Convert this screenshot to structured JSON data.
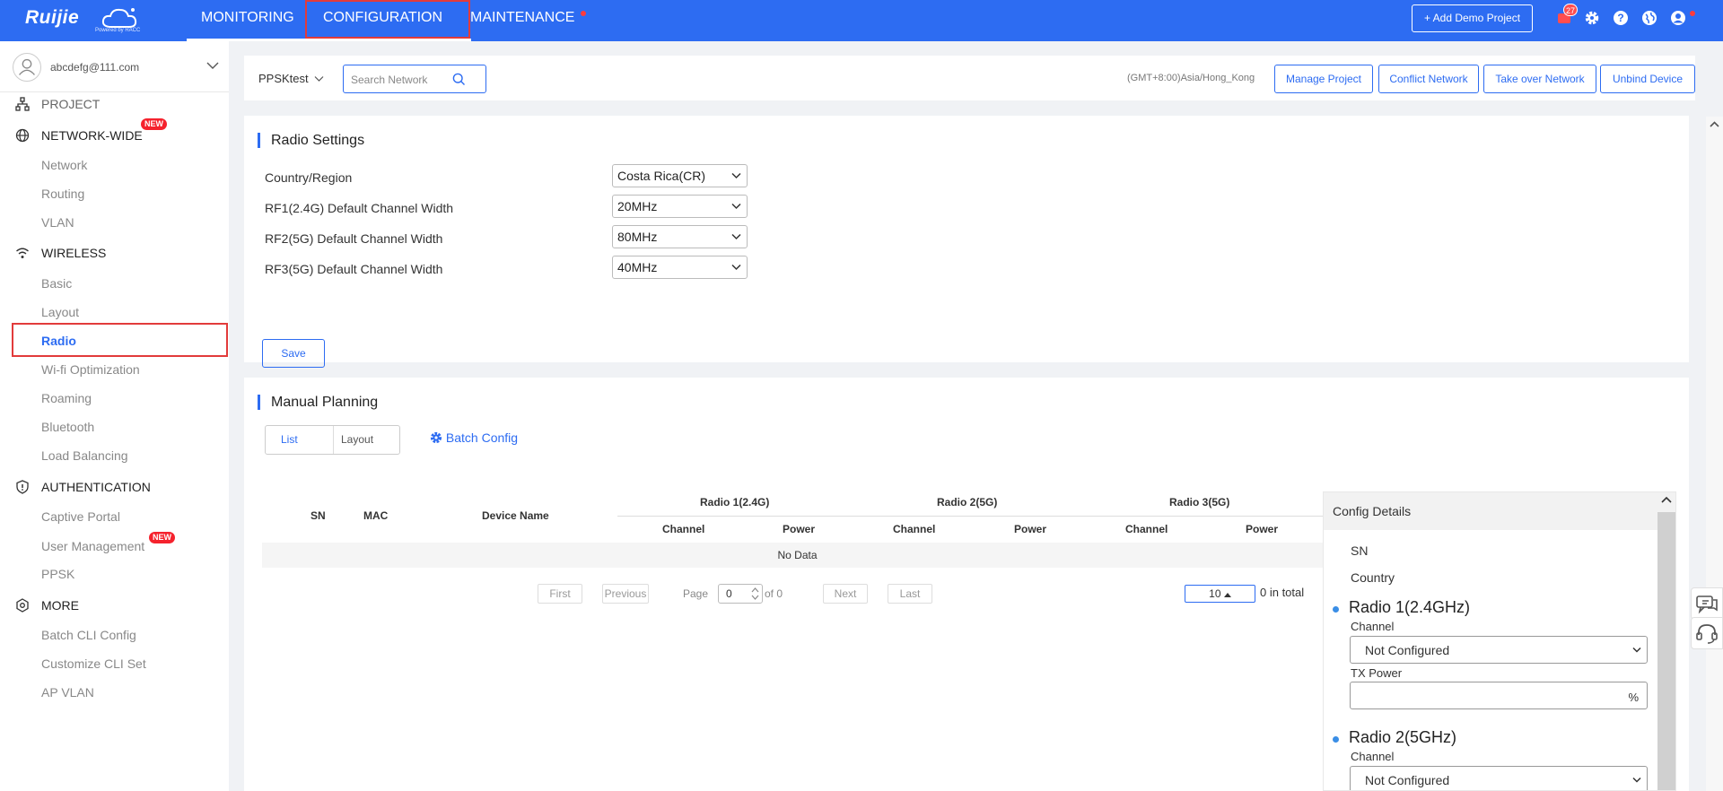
{
  "nav": {
    "logo": "Ruijie",
    "logo_sub": "Powered by RACC",
    "items": [
      "MONITORING",
      "CONFIGURATION",
      "MAINTENANCE"
    ],
    "add_demo": "+ Add Demo Project",
    "message_count": "27"
  },
  "sidebar": {
    "account": "abcdefg@111.com",
    "groups": {
      "project": "PROJECT",
      "network_wide": "NETWORK-WIDE",
      "wireless": "WIRELESS",
      "authentication": "AUTHENTICATION",
      "more": "MORE"
    },
    "new_badge": "NEW",
    "network_items": [
      "Network",
      "Routing",
      "VLAN"
    ],
    "wireless_items": [
      "Basic",
      "Layout",
      "Radio",
      "Wi-fi Optimization",
      "Roaming",
      "Bluetooth",
      "Load Balancing"
    ],
    "auth_items": [
      "Captive Portal",
      "User Management",
      "PPSK"
    ],
    "more_items": [
      "Batch CLI Config",
      "Customize CLI Set",
      "AP VLAN"
    ]
  },
  "project_bar": {
    "project": "PPSKtest",
    "search_placeholder": "Search Network",
    "timezone": "(GMT+8:00)Asia/Hong_Kong",
    "buttons": [
      "Manage Project",
      "Conflict Network",
      "Take over Network",
      "Unbind Device"
    ]
  },
  "radio_settings": {
    "title": "Radio Settings",
    "fields": [
      {
        "label": "Country/Region",
        "value": "Costa Rica(CR)"
      },
      {
        "label": "RF1(2.4G) Default Channel Width",
        "value": "20MHz"
      },
      {
        "label": "RF2(5G) Default Channel Width",
        "value": "80MHz"
      },
      {
        "label": "RF3(5G) Default Channel Width",
        "value": "40MHz"
      }
    ],
    "save": "Save"
  },
  "manual_planning": {
    "title": "Manual Planning",
    "tabs": [
      "List",
      "Layout"
    ],
    "batch_config": "Batch Config",
    "table": {
      "columns": [
        "SN",
        "MAC",
        "Device Name"
      ],
      "groups": [
        "Radio 1(2.4G)",
        "Radio 2(5G)",
        "Radio 3(5G)"
      ],
      "subcolumns": [
        "Channel",
        "Power"
      ],
      "empty": "No Data"
    },
    "pagination": {
      "first": "First",
      "previous": "Previous",
      "page_label": "Page",
      "page_value": "0",
      "of_text": "of 0",
      "next": "Next",
      "last": "Last",
      "page_size": "10",
      "total": "0 in total"
    }
  },
  "config_details": {
    "title": "Config Details",
    "sn": "SN",
    "country": "Country",
    "radio1": "Radio 1(2.4GHz)",
    "radio2": "Radio 2(5GHz)",
    "channel": "Channel",
    "tx_power": "TX Power",
    "not_configured": "Not Configured",
    "percent": "%"
  },
  "colors": {
    "primary": "#2d6cf2",
    "highlight": "#e23b3b",
    "badge": "#f5222d"
  }
}
